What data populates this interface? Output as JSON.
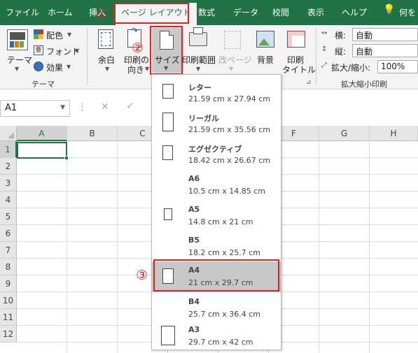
{
  "tabs": [
    "ファイル",
    "ホーム",
    "挿入",
    "ページ レイアウト",
    "数式",
    "データ",
    "校閲",
    "表示",
    "ヘルプ",
    "何を"
  ],
  "theme_group": {
    "themes_label": "テーマ",
    "colors_label": "配色",
    "fonts_label": "フォント",
    "effects_label": "効果",
    "group_label": "テーマ"
  },
  "page_setup": {
    "margins_label": "余白",
    "orientation_line1": "印刷の",
    "orientation_line2": "向き",
    "size_label": "サイズ",
    "print_area_label": "印刷範囲",
    "breaks_label": "改ページ",
    "background_label": "背景",
    "print_titles_line1": "印刷",
    "print_titles_line2": "タイトル"
  },
  "scale": {
    "width_label": "横:",
    "width_value": "自動",
    "height_label": "縦:",
    "height_value": "自動",
    "scale_label": "拡大/縮小:",
    "scale_value": "100%",
    "group_label": "拡大縮小印刷"
  },
  "formula_bar": {
    "name_box": "A1"
  },
  "columns": [
    "A",
    "B",
    "C",
    "D",
    "E",
    "F",
    "G",
    "H"
  ],
  "rows": [
    "1",
    "2",
    "3",
    "4",
    "5",
    "6",
    "7",
    "8",
    "9",
    "10",
    "11",
    "12"
  ],
  "size_menu": {
    "items": [
      {
        "name": "レター",
        "size": "21.59 cm x 27.94 cm"
      },
      {
        "name": "リーガル",
        "size": "21.59 cm x 35.56 cm"
      },
      {
        "name": "エグゼクティブ",
        "size": "18.42 cm x 26.67 cm"
      },
      {
        "name": "A6",
        "size": "10.5 cm x 14.85 cm"
      },
      {
        "name": "A5",
        "size": "14.8 cm x 21 cm"
      },
      {
        "name": "B5",
        "size": "18.2 cm x 25.7 cm"
      },
      {
        "name": "A4",
        "size": "21 cm x 29.7 cm"
      },
      {
        "name": "B4",
        "size": "25.7 cm x 36.4 cm"
      },
      {
        "name": "A3",
        "size": "29.7 cm x 42 cm"
      }
    ],
    "selected_index": 6
  },
  "annotations": [
    "①",
    "②",
    "③"
  ],
  "colors": {
    "ribbon_green": "#217346",
    "annotation_red": "#e02020",
    "selection_gray": "#c8c8c8"
  }
}
